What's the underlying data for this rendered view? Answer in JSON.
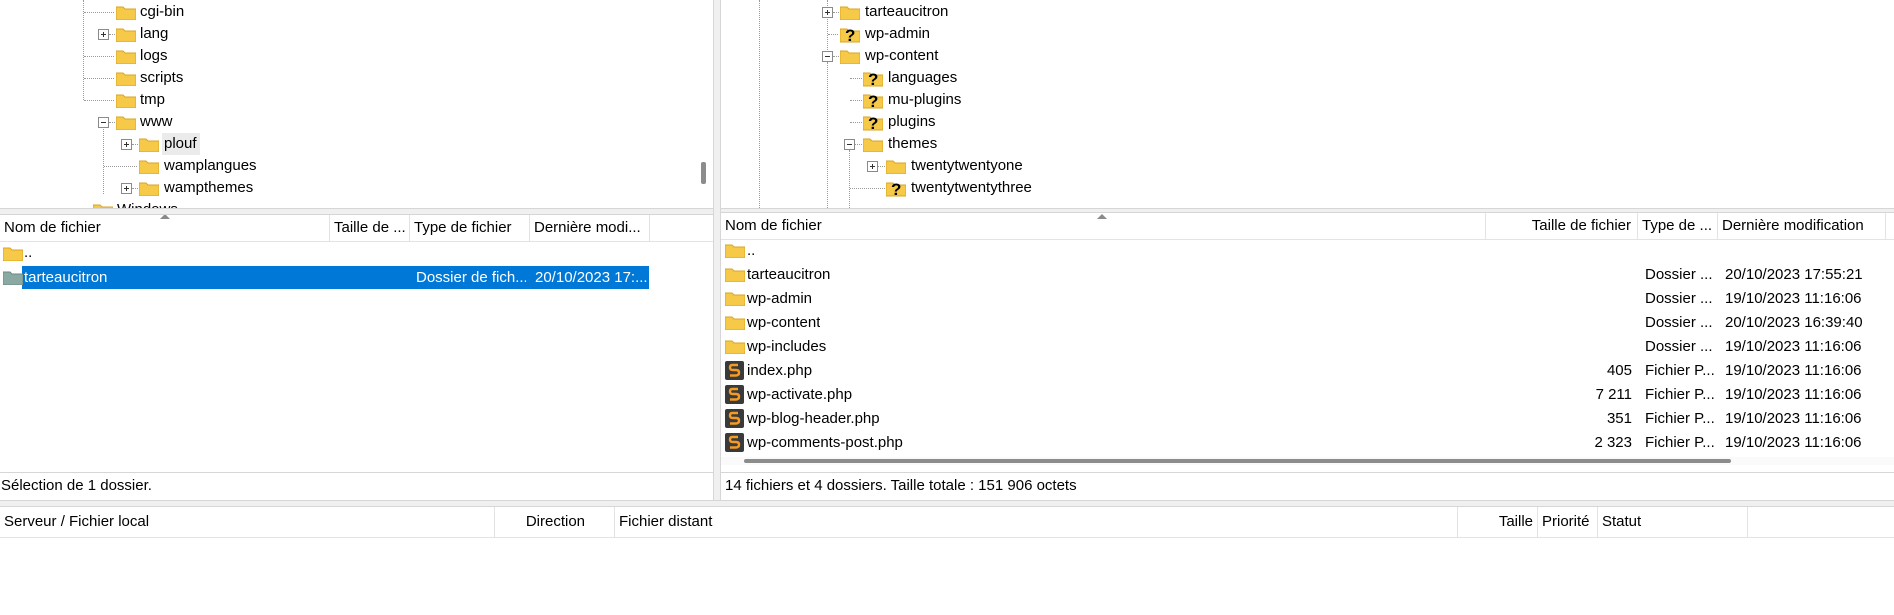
{
  "local_tree": {
    "items": [
      {
        "label": "cgi-bin",
        "icon": "folder-icon"
      },
      {
        "label": "lang",
        "icon": "folder-icon",
        "expander": "plus"
      },
      {
        "label": "logs",
        "icon": "folder-icon"
      },
      {
        "label": "scripts",
        "icon": "folder-icon"
      },
      {
        "label": "tmp",
        "icon": "folder-icon"
      },
      {
        "label": "www",
        "icon": "folder-icon",
        "expander": "minus"
      },
      {
        "label": "plouf",
        "icon": "folder-icon",
        "expander": "plus",
        "highlighted": true
      },
      {
        "label": "wamplangues",
        "icon": "folder-icon"
      },
      {
        "label": "wampthemes",
        "icon": "folder-icon",
        "expander": "plus"
      },
      {
        "label": "Windows",
        "icon": "folder-icon"
      }
    ]
  },
  "remote_tree": {
    "items": [
      {
        "label": "tarteaucitron",
        "icon": "folder-icon",
        "expander": "plus"
      },
      {
        "label": "wp-admin",
        "icon": "unknown-folder-icon"
      },
      {
        "label": "wp-content",
        "icon": "folder-icon",
        "expander": "minus"
      },
      {
        "label": "languages",
        "icon": "unknown-folder-icon"
      },
      {
        "label": "mu-plugins",
        "icon": "unknown-folder-icon"
      },
      {
        "label": "plugins",
        "icon": "unknown-folder-icon"
      },
      {
        "label": "themes",
        "icon": "folder-icon",
        "expander": "minus"
      },
      {
        "label": "twentytwentyone",
        "icon": "folder-icon",
        "expander": "plus"
      },
      {
        "label": "twentytwentythree",
        "icon": "unknown-folder-icon"
      }
    ]
  },
  "local_list": {
    "headers": {
      "name": "Nom de fichier",
      "size": "Taille de ...",
      "type": "Type de fichier",
      "modified": "Dernière modi..."
    },
    "rows": [
      {
        "name": "..",
        "size": "",
        "type": "",
        "modified": ""
      },
      {
        "name": "tarteaucitron",
        "size": "",
        "type": "Dossier de fich...",
        "modified": "20/10/2023 17:...",
        "selected": true
      }
    ],
    "status": "Sélection de 1 dossier."
  },
  "remote_list": {
    "headers": {
      "name": "Nom de fichier",
      "size": "Taille de fichier",
      "type": "Type de ...",
      "modified": "Dernière modification"
    },
    "rows": [
      {
        "name": "..",
        "size": "",
        "type": "",
        "modified": "",
        "icon": "folder-icon"
      },
      {
        "name": "tarteaucitron",
        "size": "",
        "type": "Dossier ...",
        "modified": "20/10/2023 17:55:21",
        "icon": "folder-icon"
      },
      {
        "name": "wp-admin",
        "size": "",
        "type": "Dossier ...",
        "modified": "19/10/2023 11:16:06",
        "icon": "folder-icon"
      },
      {
        "name": "wp-content",
        "size": "",
        "type": "Dossier ...",
        "modified": "20/10/2023 16:39:40",
        "icon": "folder-icon"
      },
      {
        "name": "wp-includes",
        "size": "",
        "type": "Dossier ...",
        "modified": "19/10/2023 11:16:06",
        "icon": "folder-icon"
      },
      {
        "name": "index.php",
        "size": "405",
        "type": "Fichier P...",
        "modified": "19/10/2023 11:16:06",
        "icon": "php-file-icon"
      },
      {
        "name": "wp-activate.php",
        "size": "7 211",
        "type": "Fichier P...",
        "modified": "19/10/2023 11:16:06",
        "icon": "php-file-icon"
      },
      {
        "name": "wp-blog-header.php",
        "size": "351",
        "type": "Fichier P...",
        "modified": "19/10/2023 11:16:06",
        "icon": "php-file-icon"
      },
      {
        "name": "wp-comments-post.php",
        "size": "2 323",
        "type": "Fichier P...",
        "modified": "19/10/2023 11:16:06",
        "icon": "php-file-icon"
      }
    ],
    "status": "14 fichiers et 4 dossiers. Taille totale : 151 906 octets"
  },
  "queue": {
    "headers": {
      "server_local": "Serveur / Fichier local",
      "direction": "Direction",
      "remote_file": "Fichier distant",
      "size": "Taille",
      "priority": "Priorité",
      "status": "Statut"
    }
  },
  "colors": {
    "selection": "#0078d7",
    "folder": "#f7c948",
    "php_icon_bg": "#3a3a3a",
    "php_icon_fg": "#f59a23"
  }
}
